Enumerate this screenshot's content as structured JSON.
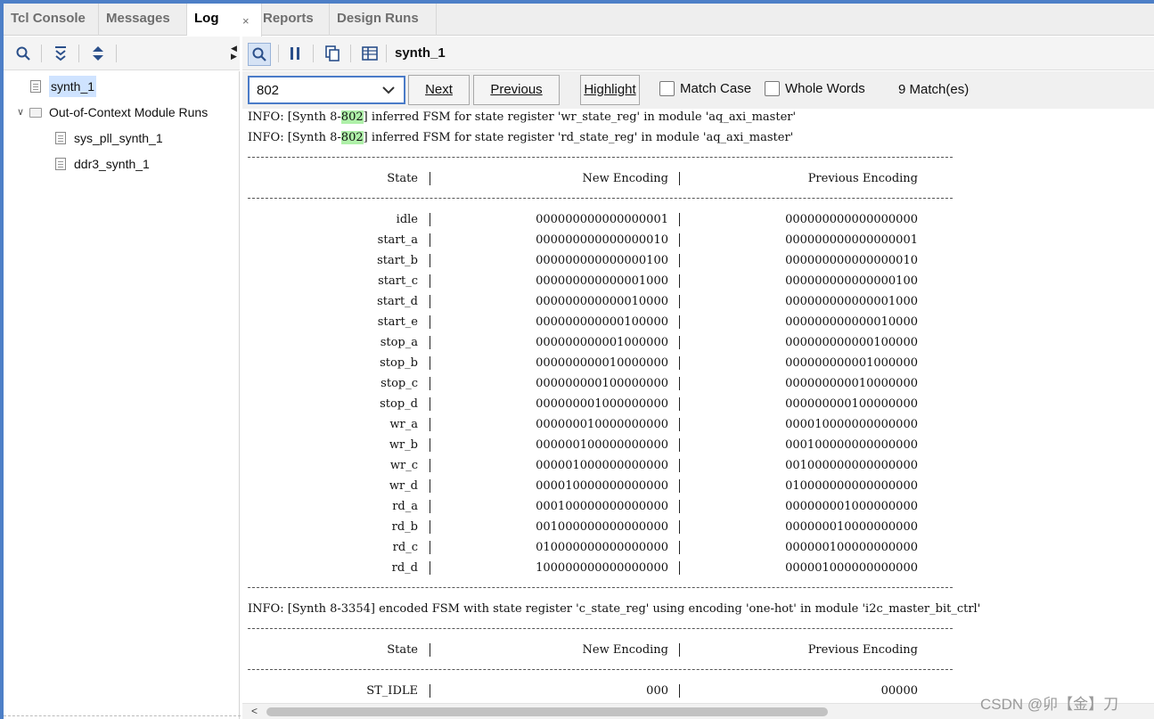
{
  "tabs": [
    {
      "label": "Tcl Console"
    },
    {
      "label": "Messages"
    },
    {
      "label": "Log"
    },
    {
      "label": "Reports"
    },
    {
      "label": "Design Runs"
    }
  ],
  "tab_close": "×",
  "tree": {
    "items": [
      {
        "label": "synth_1"
      },
      {
        "label": "Out-of-Context Module Runs"
      },
      {
        "label": "sys_pll_synth_1"
      },
      {
        "label": "ddr3_synth_1"
      }
    ]
  },
  "toolbar": {
    "run_name": "synth_1"
  },
  "search": {
    "value": "802",
    "next_label": "Next",
    "previous_label": "Previous",
    "highlight_label": "Highlight",
    "match_case_label": "Match Case",
    "whole_words_label": "Whole Words",
    "matches": "9 Match(es)"
  },
  "log": {
    "line1_pre": "INFO: [Synth 8-",
    "line1_hl": "802",
    "line1_post": "] inferred FSM for state register 'wr_state_reg' in module 'aq_axi_master'",
    "line2_pre": "INFO: [Synth 8-",
    "line2_hl": "802",
    "line2_post": "] inferred FSM for state register 'rd_state_reg' in module 'aq_axi_master'",
    "headers": [
      "State",
      "New Encoding",
      "Previous Encoding"
    ],
    "rows": [
      [
        "idle",
        "000000000000000001",
        "000000000000000000"
      ],
      [
        "start_a",
        "000000000000000010",
        "000000000000000001"
      ],
      [
        "start_b",
        "000000000000000100",
        "000000000000000010"
      ],
      [
        "start_c",
        "000000000000001000",
        "000000000000000100"
      ],
      [
        "start_d",
        "000000000000010000",
        "000000000000001000"
      ],
      [
        "start_e",
        "000000000000100000",
        "000000000000010000"
      ],
      [
        "stop_a",
        "000000000001000000",
        "000000000000100000"
      ],
      [
        "stop_b",
        "000000000010000000",
        "000000000001000000"
      ],
      [
        "stop_c",
        "000000000100000000",
        "000000000010000000"
      ],
      [
        "stop_d",
        "000000001000000000",
        "000000000100000000"
      ],
      [
        "wr_a",
        "000000010000000000",
        "000010000000000000"
      ],
      [
        "wr_b",
        "000000100000000000",
        "000100000000000000"
      ],
      [
        "wr_c",
        "000001000000000000",
        "001000000000000000"
      ],
      [
        "wr_d",
        "000010000000000000",
        "010000000000000000"
      ],
      [
        "rd_a",
        "000100000000000000",
        "000000001000000000"
      ],
      [
        "rd_b",
        "001000000000000000",
        "000000010000000000"
      ],
      [
        "rd_c",
        "010000000000000000",
        "000000100000000000"
      ],
      [
        "rd_d",
        "100000000000000000",
        "000001000000000000"
      ]
    ],
    "line3": "INFO: [Synth 8-3354] encoded FSM with state register 'c_state_reg' using encoding 'one-hot' in module 'i2c_master_bit_ctrl'",
    "headers2": [
      "State",
      "New Encoding",
      "Previous Encoding"
    ],
    "last_row": [
      "ST_IDLE",
      "000",
      "00000"
    ]
  },
  "watermark": "CSDN @卯【金】刀",
  "icons": {
    "search": "search-icon",
    "collapse_all": "collapse-all-icon",
    "expand_all": "expand-all-icon",
    "pause": "pause-icon",
    "copy": "copy-icon",
    "columns": "columns-icon"
  },
  "colors": {
    "accent": "#4d7fc7",
    "match_highlight": "#aef0a8",
    "selection": "#cfe3ff"
  }
}
